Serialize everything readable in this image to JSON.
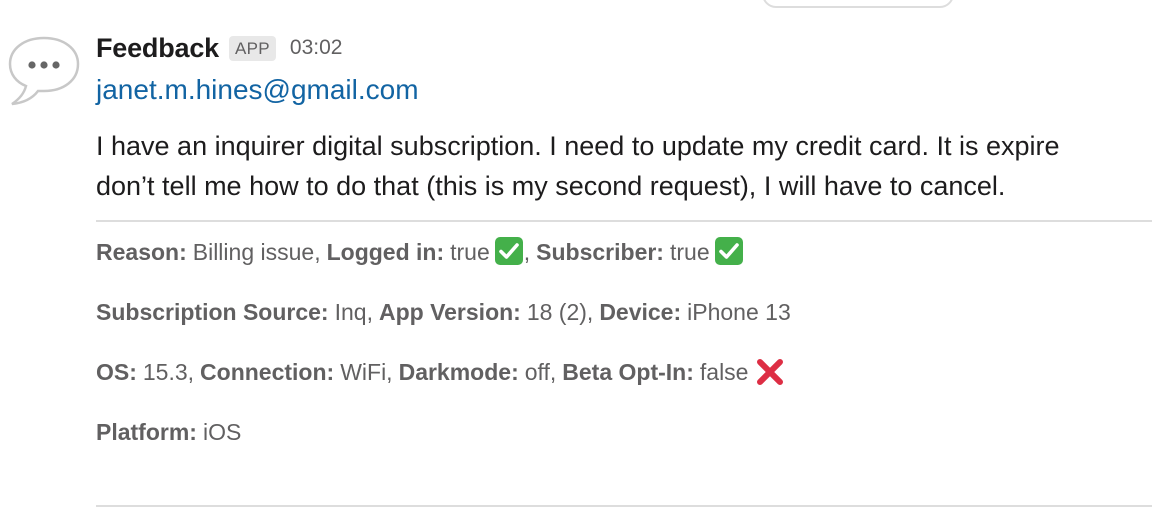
{
  "message": {
    "sender": "Feedback",
    "app_badge": "APP",
    "timestamp": "03:02",
    "email": "janet.m.hines@gmail.com",
    "body_line1": "I have an inquirer digital subscription. I need to update my credit card. It is expire",
    "body_line2": "don’t tell me how to do that (this is my second request), I will have to cancel."
  },
  "fields": {
    "reason_label": "Reason:",
    "reason_value": "Billing issue,",
    "logged_in_label": "Logged in:",
    "logged_in_value": "true",
    "logged_in_sep": ",",
    "subscriber_label": "Subscriber:",
    "subscriber_value": "true",
    "subscription_source_label": "Subscription Source:",
    "subscription_source_value": "Inq,",
    "app_version_label": "App Version:",
    "app_version_value": "18 (2),",
    "device_label": "Device:",
    "device_value": "iPhone 13",
    "os_label": "OS:",
    "os_value": "15.3,",
    "connection_label": "Connection:",
    "connection_value": "WiFi,",
    "darkmode_label": "Darkmode:",
    "darkmode_value": "off,",
    "beta_label": "Beta Opt-In:",
    "beta_value": "false",
    "platform_label": "Platform:",
    "platform_value": "iOS"
  },
  "icons": {
    "avatar": "speech-bubble-ellipsis-icon",
    "true_marker": "green-check-icon",
    "false_marker": "red-cross-icon"
  },
  "colors": {
    "link": "#1264a3",
    "check_green": "#44b04a",
    "cross_red": "#dd2e44"
  }
}
